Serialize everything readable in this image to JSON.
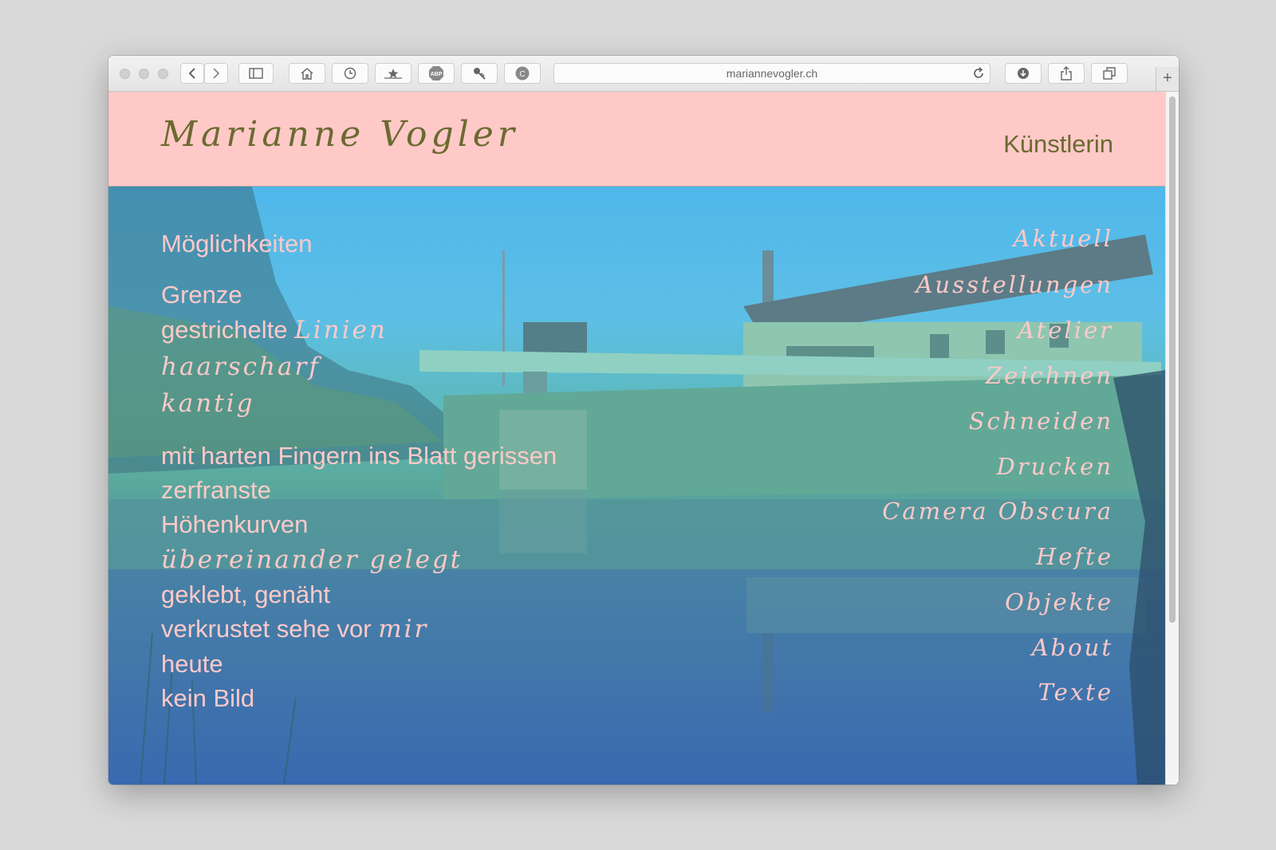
{
  "browser": {
    "url": "mariannevogler.ch",
    "new_tab": "+"
  },
  "site": {
    "logo": "Marianne Vogler",
    "role": "Künstlerin"
  },
  "poem": {
    "title": "Möglichkeiten",
    "lines": [
      {
        "plain": "Grenze",
        "script": ""
      },
      {
        "plain": "gestrichelte ",
        "script": "Linien"
      },
      {
        "plain": "",
        "script": "haarscharf"
      },
      {
        "plain": "",
        "script": "kantig"
      },
      {
        "plain": "mit harten Fingern ins Blatt gerissen",
        "script": ""
      },
      {
        "plain": "zerfranste",
        "script": ""
      },
      {
        "plain": "Höhenkurven",
        "script": ""
      },
      {
        "plain": "",
        "script": "übereinander gelegt"
      },
      {
        "plain": "geklebt, genäht",
        "script": ""
      },
      {
        "plain": "verkrustet sehe vor ",
        "script": "mir"
      },
      {
        "plain": "heute",
        "script": ""
      },
      {
        "plain": "kein Bild",
        "script": ""
      }
    ]
  },
  "nav": {
    "items": [
      "Aktuell",
      "Ausstellungen",
      "Atelier",
      "Zeichnen",
      "Schneiden",
      "Drucken",
      "Camera Obscura",
      "Hefte",
      "Objekte",
      "About",
      "Texte"
    ]
  },
  "icons": [
    "back-icon",
    "forward-icon",
    "sidebar-icon",
    "home-icon",
    "history-icon",
    "bookmark-icon",
    "adblock-icon",
    "key-icon",
    "extension-icon",
    "reload-icon",
    "download-icon",
    "share-icon",
    "tabs-icon"
  ],
  "colors": {
    "header_bg": "#ffc9c8",
    "logo_text": "#6b6a30",
    "nav_text": "#ffc9c8"
  }
}
